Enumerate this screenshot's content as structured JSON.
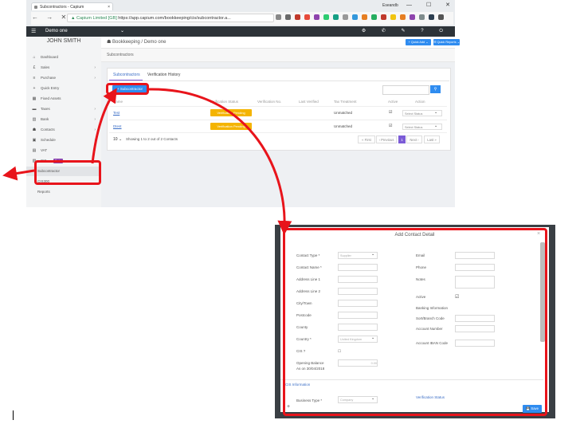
{
  "browser": {
    "tab_title": "Subcontractors - Capium",
    "tab_close": "×",
    "window_user": "Eseandb",
    "window_controls": "— ☐ ✕",
    "nav_buttons": "← → ✕",
    "url_secure": "Capium Limited [GB]",
    "url_rest": "https://app.capium.com/bookkeeping/cis/subcontractor.a...",
    "extension_icons": [
      "star-icon",
      "ext-icon",
      "ext-icon",
      "ext-icon",
      "ext-icon",
      "ext-icon",
      "ext-icon",
      "ext-icon",
      "ext-icon",
      "ext-icon",
      "ext-icon",
      "ext-icon",
      "ext-icon",
      "ext-icon",
      "ext-icon",
      "ext-icon",
      "ext-icon",
      "menu-icon"
    ],
    "extension_colors": [
      "#888888",
      "#6a6a6a",
      "#c0392b",
      "#e74c3c",
      "#8e44ad",
      "#2ecc71",
      "#16a085",
      "#999999",
      "#3498db",
      "#e67e22",
      "#27ae60",
      "#c0392b",
      "#f1c40f",
      "#e67e22",
      "#8e44ad",
      "#7f8c8d",
      "#2c3e50",
      "#555555"
    ]
  },
  "topbar": {
    "menu_icon": "☰",
    "company": "Demo one",
    "caret": "⌄",
    "icons": "⚙ ✆ ✎ ? ⏻"
  },
  "sidebar": {
    "username": "JOHN SMITH",
    "items": [
      {
        "icon": "⌂",
        "label": "Dashboard",
        "chevron": ""
      },
      {
        "icon": "£",
        "label": "Sales",
        "chevron": "›"
      },
      {
        "icon": "≡",
        "label": "Purchase",
        "chevron": "›"
      },
      {
        "icon": "+",
        "label": "Quick Entry",
        "chevron": ""
      },
      {
        "icon": "▦",
        "label": "Fixed Assets",
        "chevron": ""
      },
      {
        "icon": "▬",
        "label": "Taxes",
        "chevron": "›"
      },
      {
        "icon": "▥",
        "label": "Bank",
        "chevron": "›"
      },
      {
        "icon": "☗",
        "label": "Contacts",
        "chevron": "›"
      },
      {
        "icon": "▣",
        "label": "Schedule",
        "chevron": "›"
      },
      {
        "icon": "▤",
        "label": "VAT",
        "chevron": "›"
      },
      {
        "icon": "▧",
        "label": "CIS",
        "chevron": ""
      }
    ],
    "beta": "Beta",
    "subitems": [
      "Subcontractor",
      "CIS300",
      "Reports"
    ]
  },
  "content": {
    "breadcrumb": "Bookkeeping / Demo one",
    "quick_add": "+ Quick Add ⌄",
    "quick_reports": "☰ Quick Reports ⌄",
    "page_title": "Subcontractors",
    "tabs": [
      "Subcontractors",
      "Verification History"
    ],
    "add_button": "+ Subcontractor",
    "search_button": "⚲",
    "table": {
      "headers": [
        "Name",
        "Verification Status",
        "Verification No.",
        "Last Verified",
        "Tax Treatment",
        "Active",
        "Action"
      ],
      "rows": [
        {
          "name": "Test",
          "status": "Verification Pending",
          "treatment": "Unmatched",
          "active": "☑",
          "action": "Select Status"
        },
        {
          "name": "Dtest",
          "status": "Verification Pending",
          "treatment": "Unmatched",
          "active": "☑",
          "action": "Select Status"
        }
      ]
    },
    "pager_dropdown": "10 ⌄",
    "pager_text": "Showing 1 to 2 out of 2 Contacts",
    "pager_buttons": [
      "« First",
      "‹ Previous",
      "1",
      "Next ›",
      "Last »"
    ]
  },
  "modal": {
    "title": "Add Contact Detail",
    "close": "×",
    "left_fields": [
      {
        "label": "Contact Type *",
        "value": "Supplier",
        "caret": "⌄"
      },
      {
        "label": "Contact Name *",
        "value": "",
        "caret": ""
      },
      {
        "label": "Address Line 1",
        "value": "",
        "caret": ""
      },
      {
        "label": "Address Line 2",
        "value": "",
        "caret": ""
      },
      {
        "label": "City/Town",
        "value": "",
        "caret": ""
      },
      {
        "label": "Postcode",
        "value": "",
        "caret": ""
      },
      {
        "label": "County",
        "value": "",
        "caret": ""
      },
      {
        "label": "Country *",
        "value": "United Kingdom",
        "caret": "⌄"
      },
      {
        "label": "CIS ?",
        "value": "",
        "caret": ""
      },
      {
        "label": "Opening Balance",
        "value": "0.00",
        "caret": ""
      }
    ],
    "opening_date": "As on 30/04/2018",
    "right_fields": [
      "Email",
      "Phone",
      "Notes",
      "Active",
      "Banking Information",
      "Sort/Branch Code",
      "Account Number",
      "Account IBAN Code"
    ],
    "cis_section": "CIS Information",
    "business_type_label": "Business Type *",
    "business_type_value": "Company",
    "verification_status_label": "Verification Status",
    "plus": "+",
    "save": "💾 Save"
  },
  "colors": {
    "highlight": "#e8141b",
    "primary": "#2f8cf0",
    "pending": "#f4b400",
    "accent": "#7b5bd6"
  }
}
